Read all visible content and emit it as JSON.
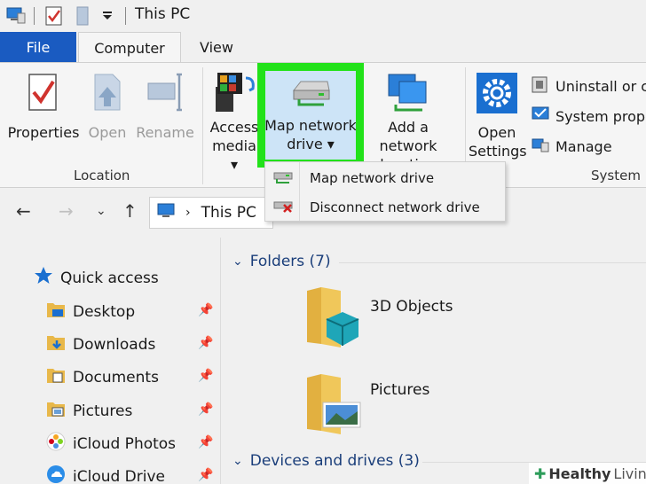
{
  "window": {
    "title": "This PC"
  },
  "ribbon_tabs": {
    "file": "File",
    "computer": "Computer",
    "view": "View"
  },
  "ribbon": {
    "properties": "Properties",
    "open": "Open",
    "rename": "Rename",
    "access_media": [
      "Access",
      "media"
    ],
    "map_network_drive": [
      "Map network",
      "drive"
    ],
    "add_network_location": [
      "Add a network",
      "location"
    ],
    "open_settings": [
      "Open",
      "Settings"
    ],
    "uninstall": "Uninstall or ch",
    "system_properties": "System prope",
    "manage": "Manage",
    "group_location": "Location",
    "group_system": "System"
  },
  "dropdown_menu": {
    "map_network_drive": "Map network drive",
    "disconnect_network_drive": "Disconnect network drive"
  },
  "address_bar": {
    "path": "This PC"
  },
  "nav_pane": {
    "quick_access": "Quick access",
    "items": [
      "Desktop",
      "Downloads",
      "Documents",
      "Pictures",
      "iCloud Photos",
      "iCloud Drive"
    ]
  },
  "content": {
    "folders_header": "Folders (7)",
    "folders": [
      "3D Objects",
      "Pictures"
    ],
    "devices_header": "Devices and drives (3)"
  },
  "watermark": {
    "brand": "Healthy",
    "brand2": "Living"
  },
  "colors": {
    "file_tab": "#1a5bc1",
    "highlight": "#22e21a",
    "selected": "#cde4f7"
  }
}
